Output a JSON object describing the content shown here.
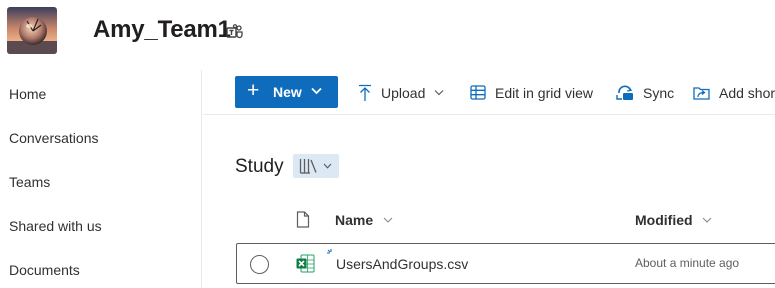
{
  "site": {
    "title": "Amy_Team1",
    "logo_icon": "site-logo-image",
    "teams_icon": "microsoft-teams-icon"
  },
  "nav": {
    "items": [
      {
        "label": "Home"
      },
      {
        "label": "Conversations"
      },
      {
        "label": "Teams"
      },
      {
        "label": "Shared with us"
      },
      {
        "label": "Documents"
      }
    ]
  },
  "toolbar": {
    "new_label": "New",
    "upload_label": "Upload",
    "edit_grid_label": "Edit in grid view",
    "sync_label": "Sync",
    "add_shortcut_label": "Add shor"
  },
  "library": {
    "title": "Study",
    "view_icon": "library-view-icon"
  },
  "table": {
    "columns": {
      "name": "Name",
      "modified": "Modified"
    },
    "rows": [
      {
        "name": "UsersAndGroups.csv",
        "modified": "About a minute ago",
        "type_icon": "excel-file-icon",
        "is_new": true
      }
    ]
  },
  "colors": {
    "accent": "#0f6cbd",
    "excel_green": "#107c41",
    "view_switch_bg": "#dde8f5"
  }
}
